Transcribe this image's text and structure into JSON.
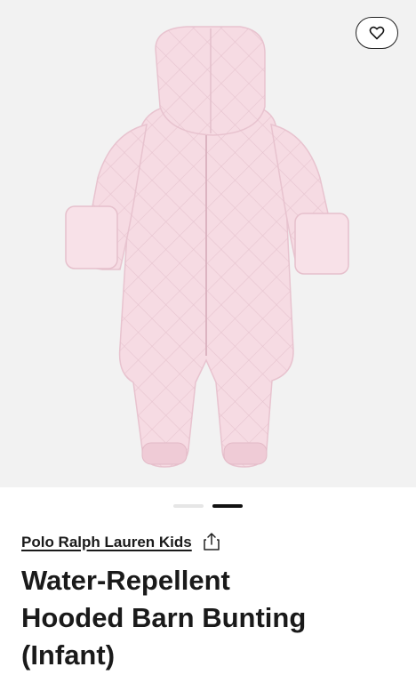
{
  "product_image": {
    "icon": "quilted-pink-bunting-image",
    "background_color": "#f2f2f2",
    "garment_color": "#f6dbe3"
  },
  "favorite": {
    "icon": "heart-outline-icon"
  },
  "carousel": {
    "count": 2,
    "active_index": 1
  },
  "product": {
    "brand": "Polo Ralph Lauren Kids",
    "share_icon": "share-icon",
    "title_lines": [
      "Water-Repellent",
      "Hooded Barn Bunting",
      "(Infant)"
    ]
  }
}
